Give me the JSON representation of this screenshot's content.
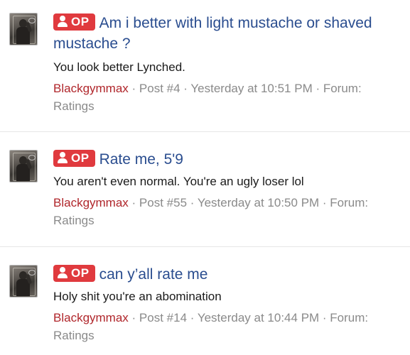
{
  "results": [
    {
      "badge": "OP",
      "title": "Am i better with light mustache or shaved mustache ?",
      "snippet": "You look better Lynched.",
      "author": "Blackgymmax",
      "meta_rest": " · Post #4 · Yesterday at 10:51 PM · Forum: Ratings"
    },
    {
      "badge": "OP",
      "title": "Rate me, 5'9",
      "snippet": "You aren't even normal. You're an ugly loser lol",
      "author": "Blackgymmax",
      "meta_rest": " · Post #55 · Yesterday at 10:50 PM · Forum: Ratings"
    },
    {
      "badge": "OP",
      "title": "can y’all rate me",
      "snippet": "Holy shit you're an abomination",
      "author": "Blackgymmax",
      "meta_rest": " · Post #14 · Yesterday at 10:44 PM · Forum: Ratings"
    }
  ],
  "colors": {
    "badge_bg": "#e03a3e",
    "title": "#2a4d8f",
    "author": "#b0262b",
    "meta": "#8a8a8a"
  },
  "icons": {
    "badge_icon": "person-icon",
    "avatar": "user-avatar-photo"
  }
}
